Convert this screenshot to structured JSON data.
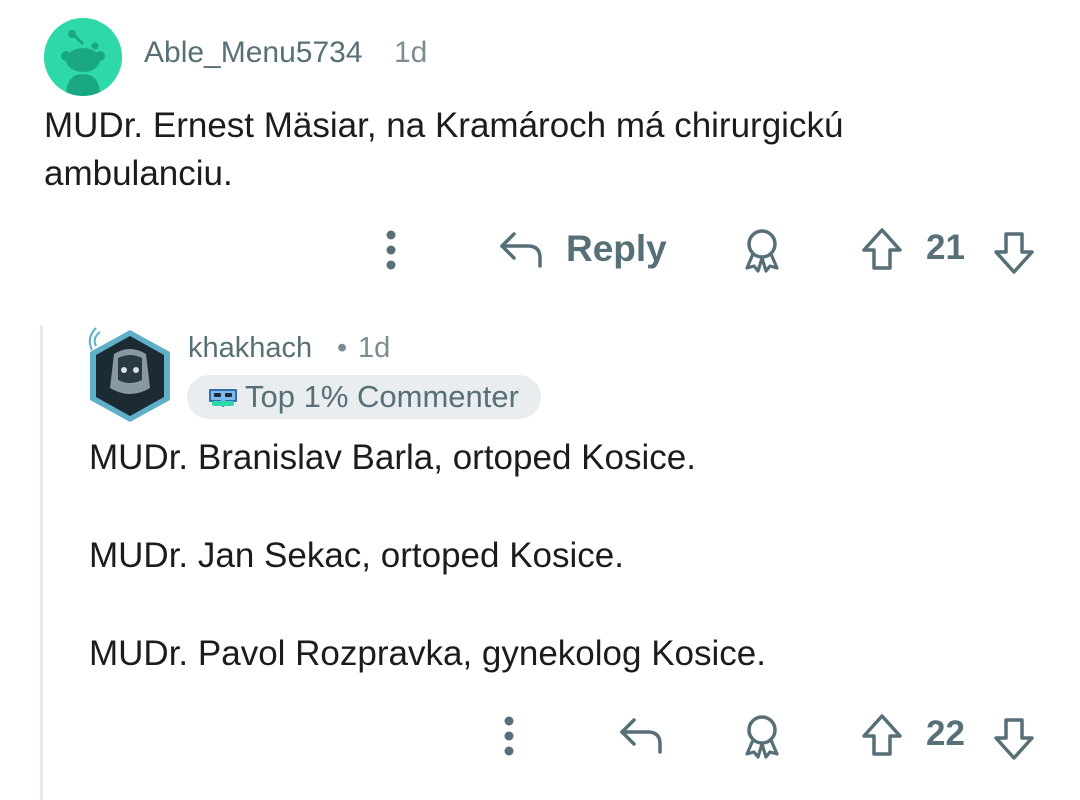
{
  "comment": {
    "author": "Able_Menu5734",
    "time": "1d",
    "body": "MUDr. Ernest Mäsiar, na Kramároch má chirurgickú ambulanciu.",
    "actions": {
      "reply_label": "Reply",
      "score": "21"
    }
  },
  "reply": {
    "author": "khakhach",
    "separator": "•",
    "time": "1d",
    "flair": "Top 1% Commenter",
    "lines": [
      "MUDr. Branislav Barla, ortoped Kosice.",
      "MUDr. Jan Sekac, ortoped Kosice.",
      "MUDr. Pavol Rozpravka, gynekolog Kosice."
    ],
    "actions": {
      "score": "22"
    }
  },
  "icons": {
    "more": "three-dots-vertical-icon",
    "reply": "reply-arrow-icon",
    "award": "award-ribbon-icon",
    "upvote": "upvote-arrow-icon",
    "downvote": "downvote-arrow-icon"
  },
  "colors": {
    "text_primary": "#1c1c1c",
    "text_meta": "#576f76",
    "avatar_bg": "#2ed8a8",
    "flair_bg": "#eaedef",
    "thread_line": "#e6eaec"
  }
}
